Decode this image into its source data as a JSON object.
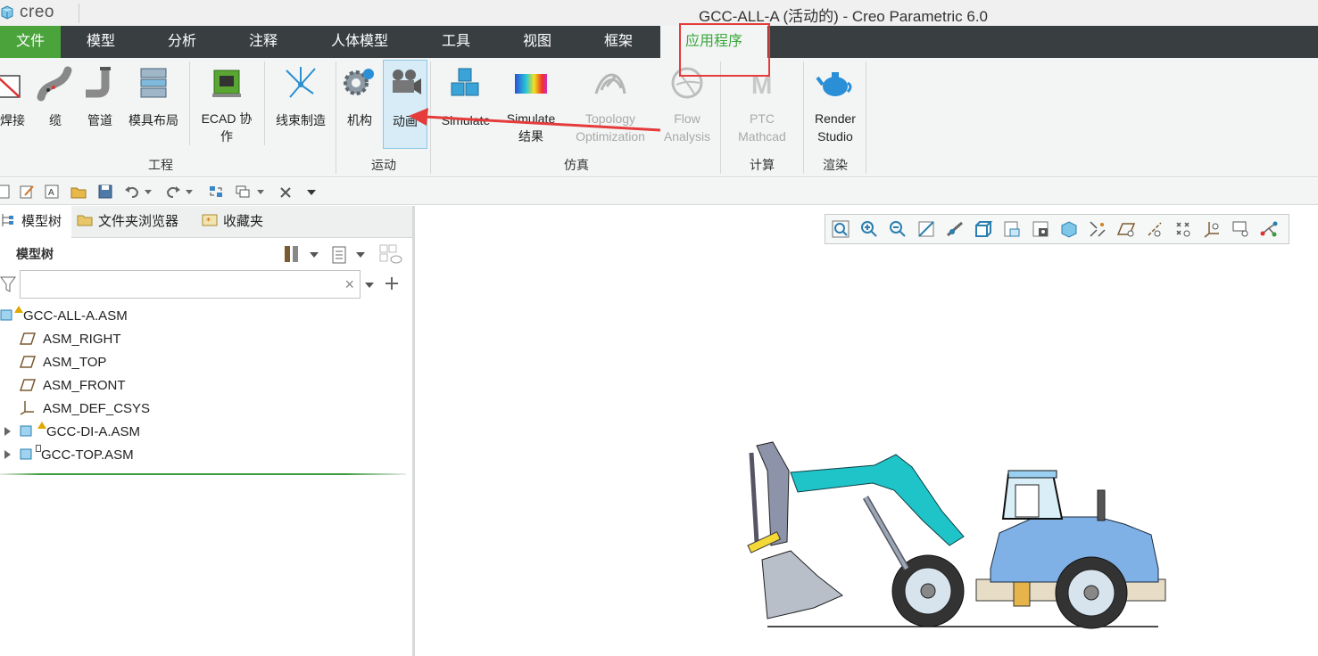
{
  "app": {
    "logo_text": "creo",
    "window_title": "GCC-ALL-A (活动的) - Creo Parametric 6.0"
  },
  "tabs": [
    {
      "label": "文件"
    },
    {
      "label": "模型"
    },
    {
      "label": "分析"
    },
    {
      "label": "注释"
    },
    {
      "label": "人体模型"
    },
    {
      "label": "工具"
    },
    {
      "label": "视图"
    },
    {
      "label": "框架"
    },
    {
      "label": "应用程序",
      "active": true
    }
  ],
  "ribbon": {
    "groups": {
      "engineering": {
        "label": "工程",
        "buttons": {
          "weld": "焊接",
          "cable": "缆",
          "piping": "管道",
          "mold_layout": "模具布局",
          "ecad_line1": "ECAD 协",
          "ecad_line2": "作",
          "harness": "线束制造"
        }
      },
      "motion": {
        "label": "运动",
        "buttons": {
          "mechanism": "机构",
          "animation": "动画"
        }
      },
      "simulation": {
        "label": "仿真",
        "buttons": {
          "simulate": "Simulate",
          "simulate_results_1": "Simulate",
          "simulate_results_2": "结果",
          "topology_1": "Topology",
          "topology_2": "Optimization",
          "flow_1": "Flow",
          "flow_2": "Analysis"
        }
      },
      "compute": {
        "label": "计算",
        "buttons": {
          "ptc_1": "PTC",
          "ptc_2": "Mathcad"
        }
      },
      "render": {
        "label": "渲染",
        "buttons": {
          "render_1": "Render",
          "render_2": "Studio"
        }
      }
    }
  },
  "left_panel": {
    "tabs": {
      "model_tree": "模型树",
      "folder_browser": "文件夹浏览器",
      "favorites": "收藏夹"
    },
    "tree_header": "模型树",
    "search": {
      "value": "",
      "clear": "×"
    },
    "items": [
      "GCC-ALL-A.ASM",
      "ASM_RIGHT",
      "ASM_TOP",
      "ASM_FRONT",
      "ASM_DEF_CSYS",
      "GCC-DI-A.ASM",
      "GCC-TOP.ASM"
    ]
  },
  "colors": {
    "tab_bar": "#393f41",
    "file_tab": "#4aa33b",
    "active_tab_text": "#3aa63a",
    "annotation_red": "#e53b3b",
    "ribbon_bg": "#f3f5f5"
  }
}
